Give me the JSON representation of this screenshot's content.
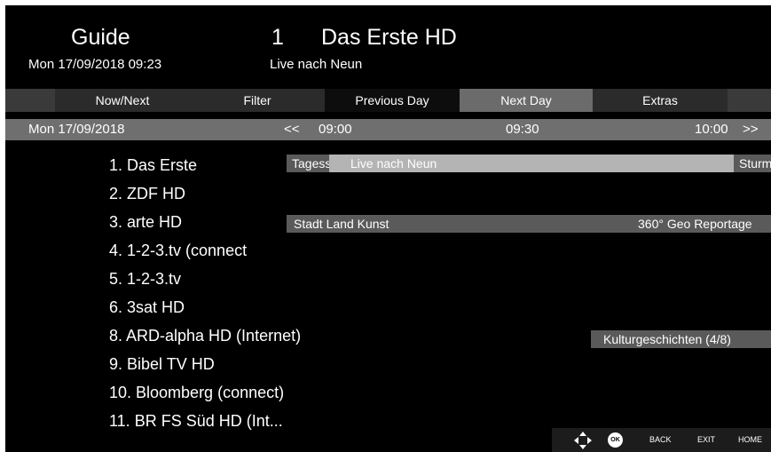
{
  "header": {
    "title": "Guide",
    "datetime": "Mon 17/09/2018 09:23",
    "channel_number": "1",
    "channel_name": "Das Erste HD",
    "current_programme": "Live nach Neun"
  },
  "menu": {
    "items": [
      "Now/Next",
      "Filter",
      "Previous Day",
      "Next Day",
      "Extras"
    ],
    "selected": "Next Day"
  },
  "timebar": {
    "date": "Mon 17/09/2018",
    "prev": "<<",
    "next": ">>",
    "times": [
      "09:00",
      "09:30",
      "10:00"
    ]
  },
  "channels": [
    "1. Das Erste",
    "2. ZDF HD",
    "3. arte HD",
    "4. 1-2-3.tv (connect",
    "5. 1-2-3.tv",
    "6. 3sat HD",
    "8. ARD-alpha HD (Internet)",
    "9. Bibel TV HD",
    "10. Bloomberg (connect)",
    "11. BR FS Süd HD (Int..."
  ],
  "programmes": {
    "das_erste": [
      "Tagess",
      "Live nach Neun",
      "Sturm"
    ],
    "arte": [
      "Stadt Land Kunst",
      "360° Geo Reportage"
    ],
    "ard_alpha": [
      "Kulturgeschichten (4/8)"
    ]
  },
  "footer": {
    "ok": "OK",
    "back": "BACK",
    "exit": "EXIT",
    "home": "HOME"
  },
  "colors": {
    "background": "#000000",
    "menu_selected": "#6b6b6b",
    "timebar": "#6f6f6f",
    "programme_dark": "#5a5a5a",
    "programme_light": "#b4b4b4"
  }
}
